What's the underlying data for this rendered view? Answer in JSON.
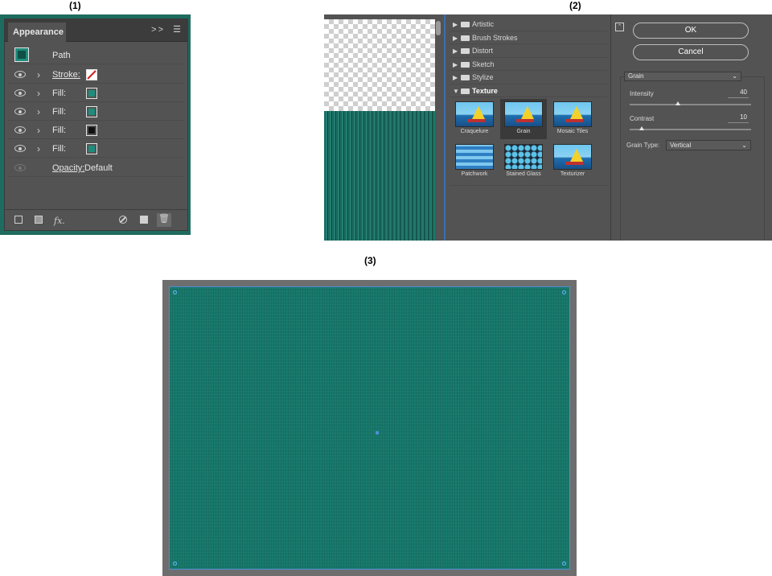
{
  "labels": {
    "p1": "(1)",
    "p2": "(2)",
    "p3": "(3)"
  },
  "appearance": {
    "tab_title": "Appearance",
    "tab_menu": ">>",
    "object_type": "Path",
    "rows": [
      {
        "name": "Stroke:",
        "swatch_color": "#ffffff",
        "swatch_kind": "none"
      },
      {
        "name": "Fill:",
        "swatch_color": "#1f8c7c",
        "swatch_kind": "color"
      },
      {
        "name": "Fill:",
        "swatch_color": "#1f8c7c",
        "swatch_kind": "color"
      },
      {
        "name": "Fill:",
        "swatch_color": "#111111",
        "swatch_kind": "color"
      },
      {
        "name": "Fill:",
        "swatch_color": "#1f8c7c",
        "swatch_kind": "color"
      }
    ],
    "opacity_label": "Opacity:",
    "opacity_value": "Default",
    "fx_label": "fx."
  },
  "filter_gallery": {
    "folders": [
      "Artistic",
      "Brush Strokes",
      "Distort",
      "Sketch",
      "Stylize"
    ],
    "open_folder": "Texture",
    "thumbnails": [
      "Craquelure",
      "Grain",
      "Mosaic Tiles",
      "Patchwork",
      "Stained Glass",
      "Texturizer"
    ],
    "selected_thumbnail": "Grain",
    "ok_label": "OK",
    "cancel_label": "Cancel",
    "filter_select": "Grain",
    "intensity_label": "Intensity",
    "intensity_value": "40",
    "contrast_label": "Contrast",
    "contrast_value": "10",
    "grain_type_label": "Grain Type:",
    "grain_type_value": "Vertical"
  },
  "colors": {
    "artboard_fill": "#16776a",
    "panel_bg": "#535353",
    "selection_blue": "#4b8fd6"
  }
}
